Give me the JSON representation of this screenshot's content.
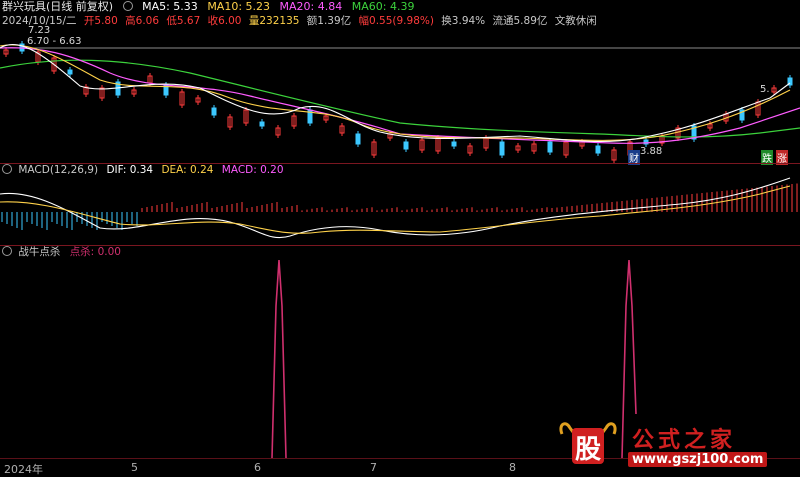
{
  "header": {
    "title": "群兴玩具(日线 前复权)",
    "ma5_label": "MA5: 5.33",
    "ma10_label": "MA10: 5.23",
    "ma20_label": "MA20: 4.84",
    "ma60_label": "MA60: 4.39"
  },
  "quote": {
    "date": "2024/10/15/二",
    "open": "开5.80",
    "high": "高6.06",
    "low": "低5.67",
    "close": "收6.00",
    "volume": "量232135",
    "amount": "额1.39亿",
    "change": "幅0.55(9.98%)",
    "turnover": "换3.94%",
    "float_cap": "流通5.89亿",
    "concept": "文教休闲"
  },
  "price_panel": {
    "high_mark": "7.23",
    "range_mark": "6.70 - 6.63",
    "low_mark": "3.88",
    "last_mark": "5.",
    "tag_fall": "跌",
    "tag_rise": "涨",
    "tag_cai": "财"
  },
  "macd_panel": {
    "title": "MACD(12,26,9)",
    "dif": "DIF: 0.34",
    "dea": "DEA: 0.24",
    "macd": "MACD: 0.20"
  },
  "signal_panel": {
    "title": "战牛点杀",
    "value": "点杀: 0.00"
  },
  "x_axis": {
    "labels": [
      "2024年",
      "5",
      "6",
      "7",
      "8"
    ]
  },
  "watermark": {
    "logo_char": "股",
    "brand": "公式之家",
    "url": "www.gszj100.com"
  },
  "colors": {
    "bg": "#000000",
    "up": "#ff3c3c",
    "down": "#3cc8ff",
    "ma5": "#ffffff",
    "ma10": "#ffd24a",
    "ma20": "#ff5cff",
    "ma60": "#3cd23c",
    "spike": "#d0306e",
    "separator": "#7a1620"
  }
}
